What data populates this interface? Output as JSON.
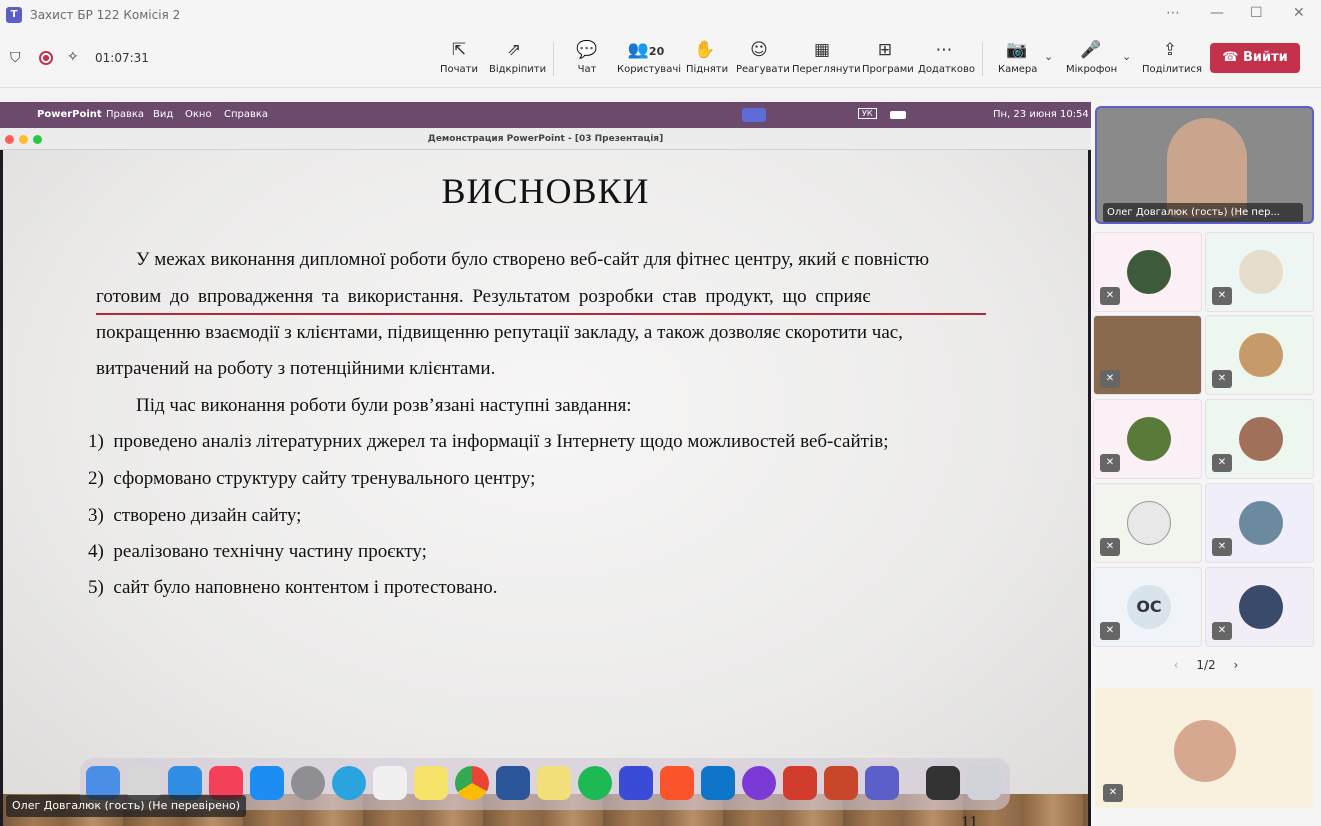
{
  "window": {
    "title": "Захист БР 122 Комісія 2",
    "min": "—",
    "max": "☐",
    "close": "✕",
    "more": "⋯"
  },
  "toolbar": {
    "timer": "01:07:31",
    "buttons": [
      {
        "icon": "⇱",
        "label": "Почати"
      },
      {
        "icon": "⇗",
        "label": "Відкріпити"
      },
      {
        "icon": "💬",
        "label": "Чат"
      },
      {
        "icon": "👥",
        "label": "Користувачі",
        "count": "20"
      },
      {
        "icon": "✋",
        "label": "Підняти"
      },
      {
        "icon": "☺",
        "label": "Реагувати"
      },
      {
        "icon": "▦",
        "label": "Переглянути"
      },
      {
        "icon": "⊞",
        "label": "Програми"
      },
      {
        "icon": "⋯",
        "label": "Додатково"
      },
      {
        "icon": "📷",
        "label": "Камера"
      },
      {
        "icon": "🎤",
        "label": "Мікрофон"
      },
      {
        "icon": "⇪",
        "label": "Поділитися"
      }
    ],
    "leave": "Вийти"
  },
  "macbar": {
    "apple": "",
    "app": "PowerPoint",
    "menus": [
      "Правка",
      "Вид",
      "Окно",
      "Справка"
    ],
    "lang": "УК",
    "clock": "Пн, 23 июня 10:54"
  },
  "ppt_window_title": "Демонстрация PowerPoint - [03 Презентація]",
  "slide": {
    "title": "ВИСНОВКИ",
    "para1": [
      "У межах виконання дипломної роботи було створено веб-сайт для фітнес центру, який є повністю",
      "готовим до впровадження та використання. Результатом розробки став продукт, що сприяє",
      "покращенню взаємодії з клієнтами, підвищенню репутації закладу, а також дозволяє скоротити час,",
      "витрачений на роботу з потенційними клієнтами."
    ],
    "para2": "Під час виконання роботи були розв’язані наступні завдання:",
    "items": [
      {
        "n": "1)",
        "t": "проведено аналіз літературних джерел та інформації з Інтернету щодо можливостей веб-сайтів;"
      },
      {
        "n": "2)",
        "t": "сформовано структуру сайту тренувального центру;"
      },
      {
        "n": "3)",
        "t": "створено дизайн сайту;"
      },
      {
        "n": "4)",
        "t": "реалізовано технічну частину проєкту;"
      },
      {
        "n": "5)",
        "t": "сайт було наповнено контентом і протестовано."
      }
    ],
    "page": "11"
  },
  "presenter": "Олег Довгалюк (гость) (Не перевірено)",
  "panel": {
    "main_name": "Олег Довгалюк (гость) (Не пер...",
    "initials": "ОС",
    "pager": "1/2",
    "prev": "‹",
    "next": "›"
  }
}
